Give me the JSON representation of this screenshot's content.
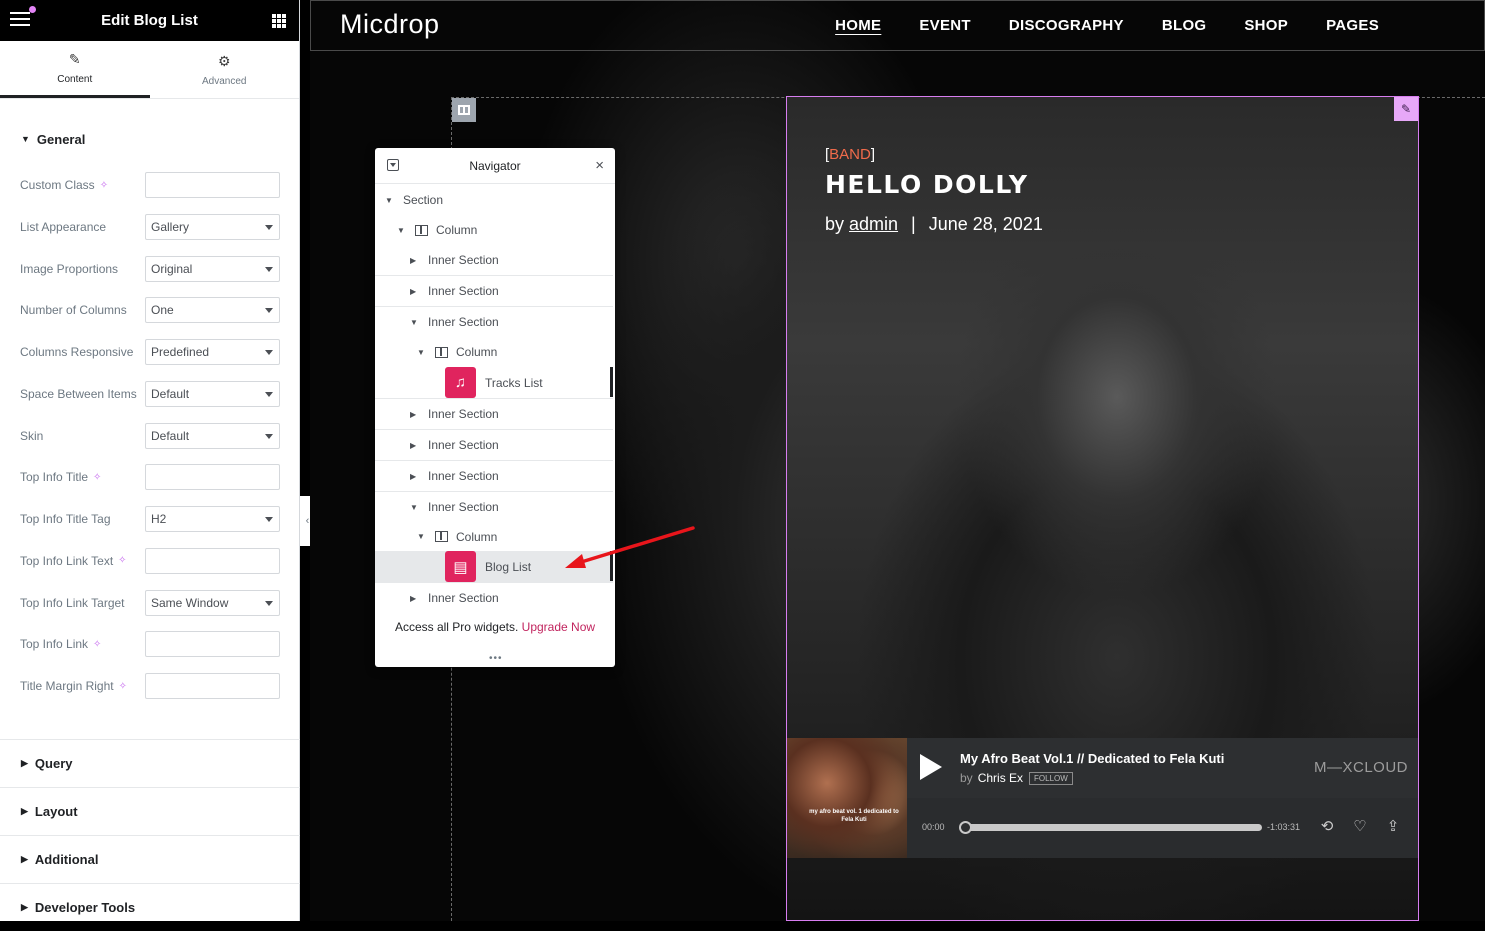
{
  "panel": {
    "title": "Edit Blog List",
    "tabs": [
      {
        "label": "Content",
        "icon": "pencil-icon"
      },
      {
        "label": "Advanced",
        "icon": "gear-icon"
      }
    ],
    "general_title": "General",
    "controls": [
      {
        "label": "Custom Class",
        "value": "",
        "ai": true
      },
      {
        "label": "List Appearance",
        "value": "Gallery",
        "select": true
      },
      {
        "label": "Image Proportions",
        "value": "Original",
        "select": true
      },
      {
        "label": "Number of Columns",
        "value": "One",
        "select": true
      },
      {
        "label": "Columns Responsive",
        "value": "Predefined",
        "select": true
      },
      {
        "label": "Space Between Items",
        "value": "Default",
        "select": true
      },
      {
        "label": "Skin",
        "value": "Default",
        "select": true
      },
      {
        "label": "Top Info Title",
        "value": "",
        "ai": true
      },
      {
        "label": "Top Info Title Tag",
        "value": "H2",
        "select": true
      },
      {
        "label": "Top Info Link Text",
        "value": "",
        "ai": true
      },
      {
        "label": "Top Info Link Target",
        "value": "Same Window",
        "select": true
      },
      {
        "label": "Top Info Link",
        "value": "",
        "ai": true
      },
      {
        "label": "Title Margin Right",
        "value": "",
        "ai": true
      }
    ],
    "sections": [
      "Query",
      "Layout",
      "Additional",
      "Developer Tools"
    ]
  },
  "site": {
    "logo": "Micdrop",
    "nav": [
      "HOME",
      "EVENT",
      "DISCOGRAPHY",
      "BLOG",
      "SHOP",
      "PAGES"
    ],
    "active_nav": "HOME"
  },
  "card": {
    "category_open": "[",
    "category": "BAND",
    "category_close": "]",
    "title": "HELLO DOLLY",
    "by": "by",
    "author": "admin",
    "separator": "|",
    "date": "June 28, 2021"
  },
  "player": {
    "track_title": "My Afro Beat Vol.1 // Dedicated to Fela Kuti",
    "by": "by",
    "artist": "Chris Ex",
    "follow": "FOLLOW",
    "logo": "M—XCLOUD",
    "art_text": "my afro beat vol. 1 dedicated to Fela Kuti",
    "time_start": "00:00",
    "time_end": "-1:03:31",
    "progress": 0
  },
  "navigator": {
    "title": "Navigator",
    "rows": [
      "Section",
      "Column",
      "Inner Section",
      "Inner Section",
      "Inner Section",
      "Column",
      "Tracks List",
      "Inner Section",
      "Inner Section",
      "Inner Section",
      "Inner Section",
      "Column",
      "Blog List",
      "Inner Section"
    ],
    "footer_text": "Access all Pro widgets.",
    "footer_link": "Upgrade Now"
  },
  "colors": {
    "accent_pink": "#d77df0",
    "widget_red": "#e0245e",
    "arrow_red": "#e8151b",
    "category_orange": "#f06b4b"
  }
}
